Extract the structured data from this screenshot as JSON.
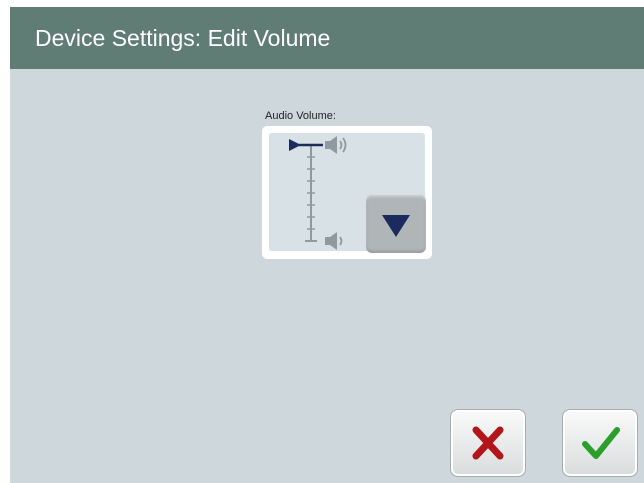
{
  "header": {
    "title": "Device Settings: Edit Volume"
  },
  "volume": {
    "label": "Audio Volume:",
    "level_fraction": 1.0
  },
  "icons": {
    "indicator": "arrow-right-indicator-icon",
    "speaker_high": "speaker-high-icon",
    "speaker_low": "speaker-low-icon",
    "down": "down-arrow-icon",
    "cancel": "close-icon",
    "confirm": "checkmark-icon"
  },
  "colors": {
    "header_bg": "#5f7d74",
    "screen_bg": "#ced8dc",
    "cancel_red": "#b2161a",
    "confirm_green": "#2aa02a",
    "arrow_navy": "#1c2a5e"
  }
}
